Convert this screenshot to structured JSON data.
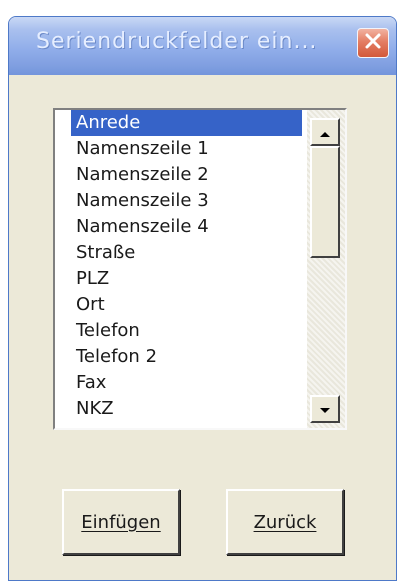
{
  "window": {
    "title": "Seriendruckfelder ein..."
  },
  "listbox": {
    "items": [
      {
        "label": "Anrede",
        "selected": true
      },
      {
        "label": "Namenszeile 1",
        "selected": false
      },
      {
        "label": "Namenszeile 2",
        "selected": false
      },
      {
        "label": "Namenszeile 3",
        "selected": false
      },
      {
        "label": "Namenszeile 4",
        "selected": false
      },
      {
        "label": "Straße",
        "selected": false
      },
      {
        "label": "PLZ",
        "selected": false
      },
      {
        "label": "Ort",
        "selected": false
      },
      {
        "label": "Telefon",
        "selected": false
      },
      {
        "label": "Telefon 2",
        "selected": false
      },
      {
        "label": "Fax",
        "selected": false
      },
      {
        "label": "NKZ",
        "selected": false
      }
    ]
  },
  "buttons": {
    "insert_label": "Einfügen",
    "back_label": "Zurück"
  },
  "colors": {
    "selection": "#3663c8",
    "dialog_face": "#ece9d8",
    "titlebar": "#91aeea",
    "close_button": "#d2593a"
  },
  "icons": {
    "close": "close-icon",
    "scroll_up": "scroll-up-arrow-icon",
    "scroll_down": "scroll-down-arrow-icon"
  }
}
